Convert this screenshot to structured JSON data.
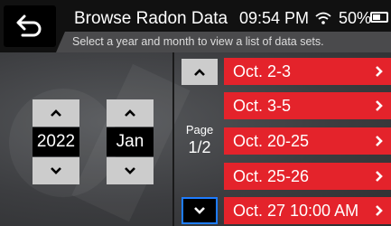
{
  "header": {
    "title": "Browse Radon Data",
    "subtitle": "Select a year and month to view a list of data sets.",
    "time": "09:54 PM",
    "battery": "50%"
  },
  "selectors": {
    "year": "2022",
    "month": "Jan"
  },
  "pager": {
    "label": "Page",
    "value": "1/2"
  },
  "datasets": [
    "Oct. 2-3",
    "Oct. 3-5",
    "Oct. 20-25",
    "Oct. 25-26",
    "Oct. 27 10:00 AM"
  ],
  "icons": {
    "back": "back-arrow-icon",
    "wifi": "wifi-icon",
    "battery": "battery-icon",
    "up": "chevron-up-icon",
    "down": "chevron-down-icon",
    "item_arrow": "chevron-right-icon"
  },
  "colors": {
    "accent": "#e4232b",
    "focus": "#1e7cff"
  }
}
